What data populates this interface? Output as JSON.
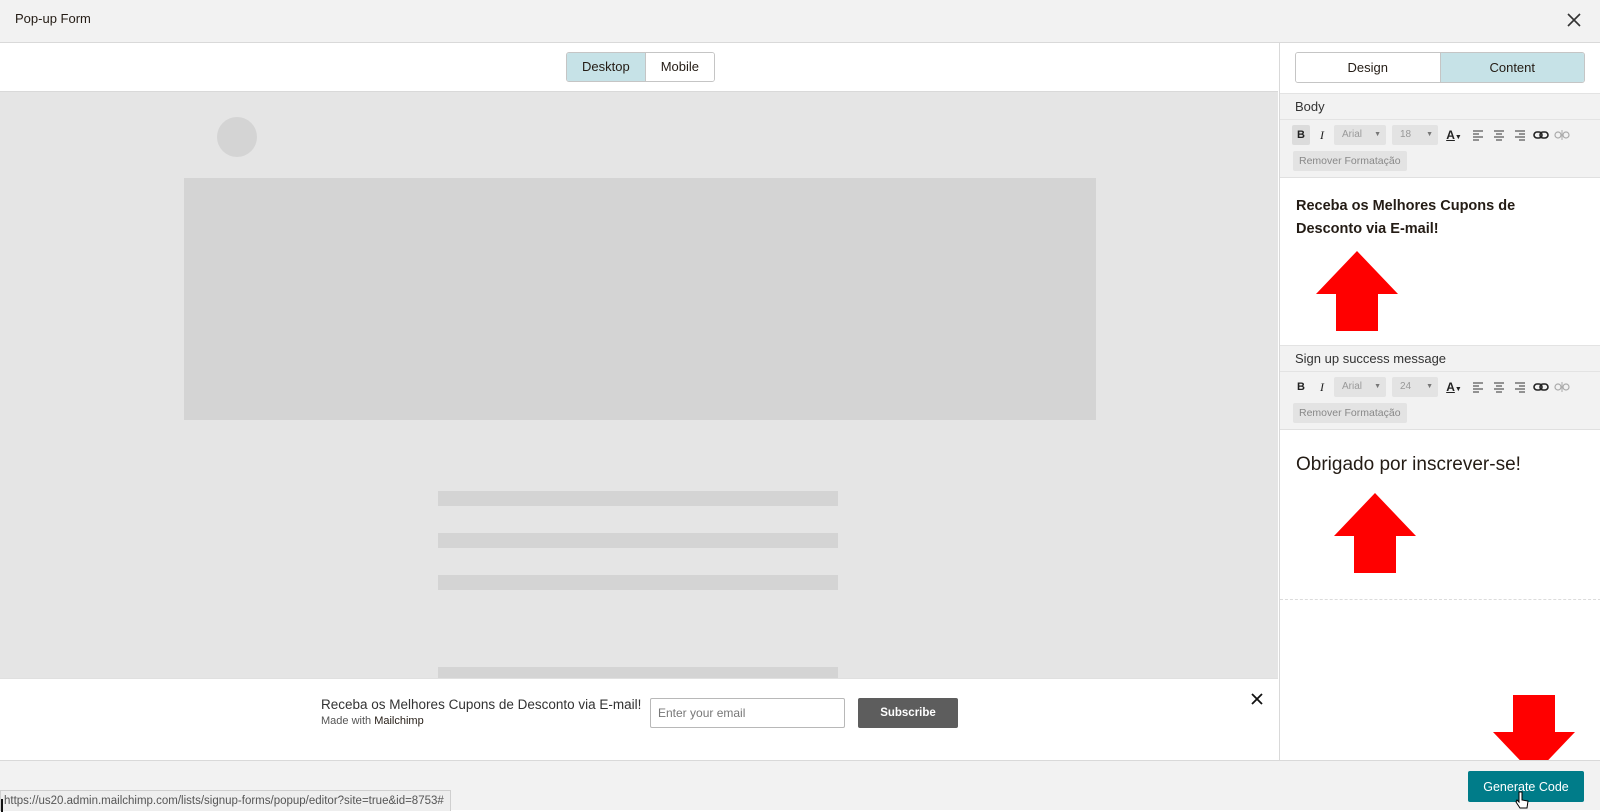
{
  "window": {
    "title": "Pop-up Form"
  },
  "preview": {
    "view_modes": [
      {
        "label": "Desktop",
        "active": true
      },
      {
        "label": "Mobile",
        "active": false
      }
    ]
  },
  "signup_bar": {
    "headline": "Receba os Melhores Cupons de Desconto via E-mail!",
    "made_with_prefix": "Made with",
    "made_with_brand": "Mailchimp",
    "email_placeholder": "Enter your email",
    "subscribe_label": "Subscribe"
  },
  "sidebar": {
    "tabs": [
      {
        "label": "Design",
        "active": false
      },
      {
        "label": "Content",
        "active": true
      }
    ],
    "sections": [
      {
        "title": "Body",
        "toolbar": {
          "font": "Arial",
          "size": "18",
          "remove_format": "Remover Formatação"
        },
        "content": "Receba os Melhores Cupons de Desconto via E-mail!"
      },
      {
        "title": "Sign up success message",
        "toolbar": {
          "font": "Arial",
          "size": "24",
          "remove_format": "Remover Formatação"
        },
        "content": "Obrigado por inscrever-se!"
      }
    ]
  },
  "footer": {
    "generate_code_label": "Generate Code",
    "status_url": "https://us20.admin.mailchimp.com/lists/signup-forms/popup/editor?site=true&id=8753#"
  },
  "colors": {
    "accent": "#007c89",
    "segment_active": "#c6e2e7",
    "annotation_arrow": "#ff0000"
  }
}
